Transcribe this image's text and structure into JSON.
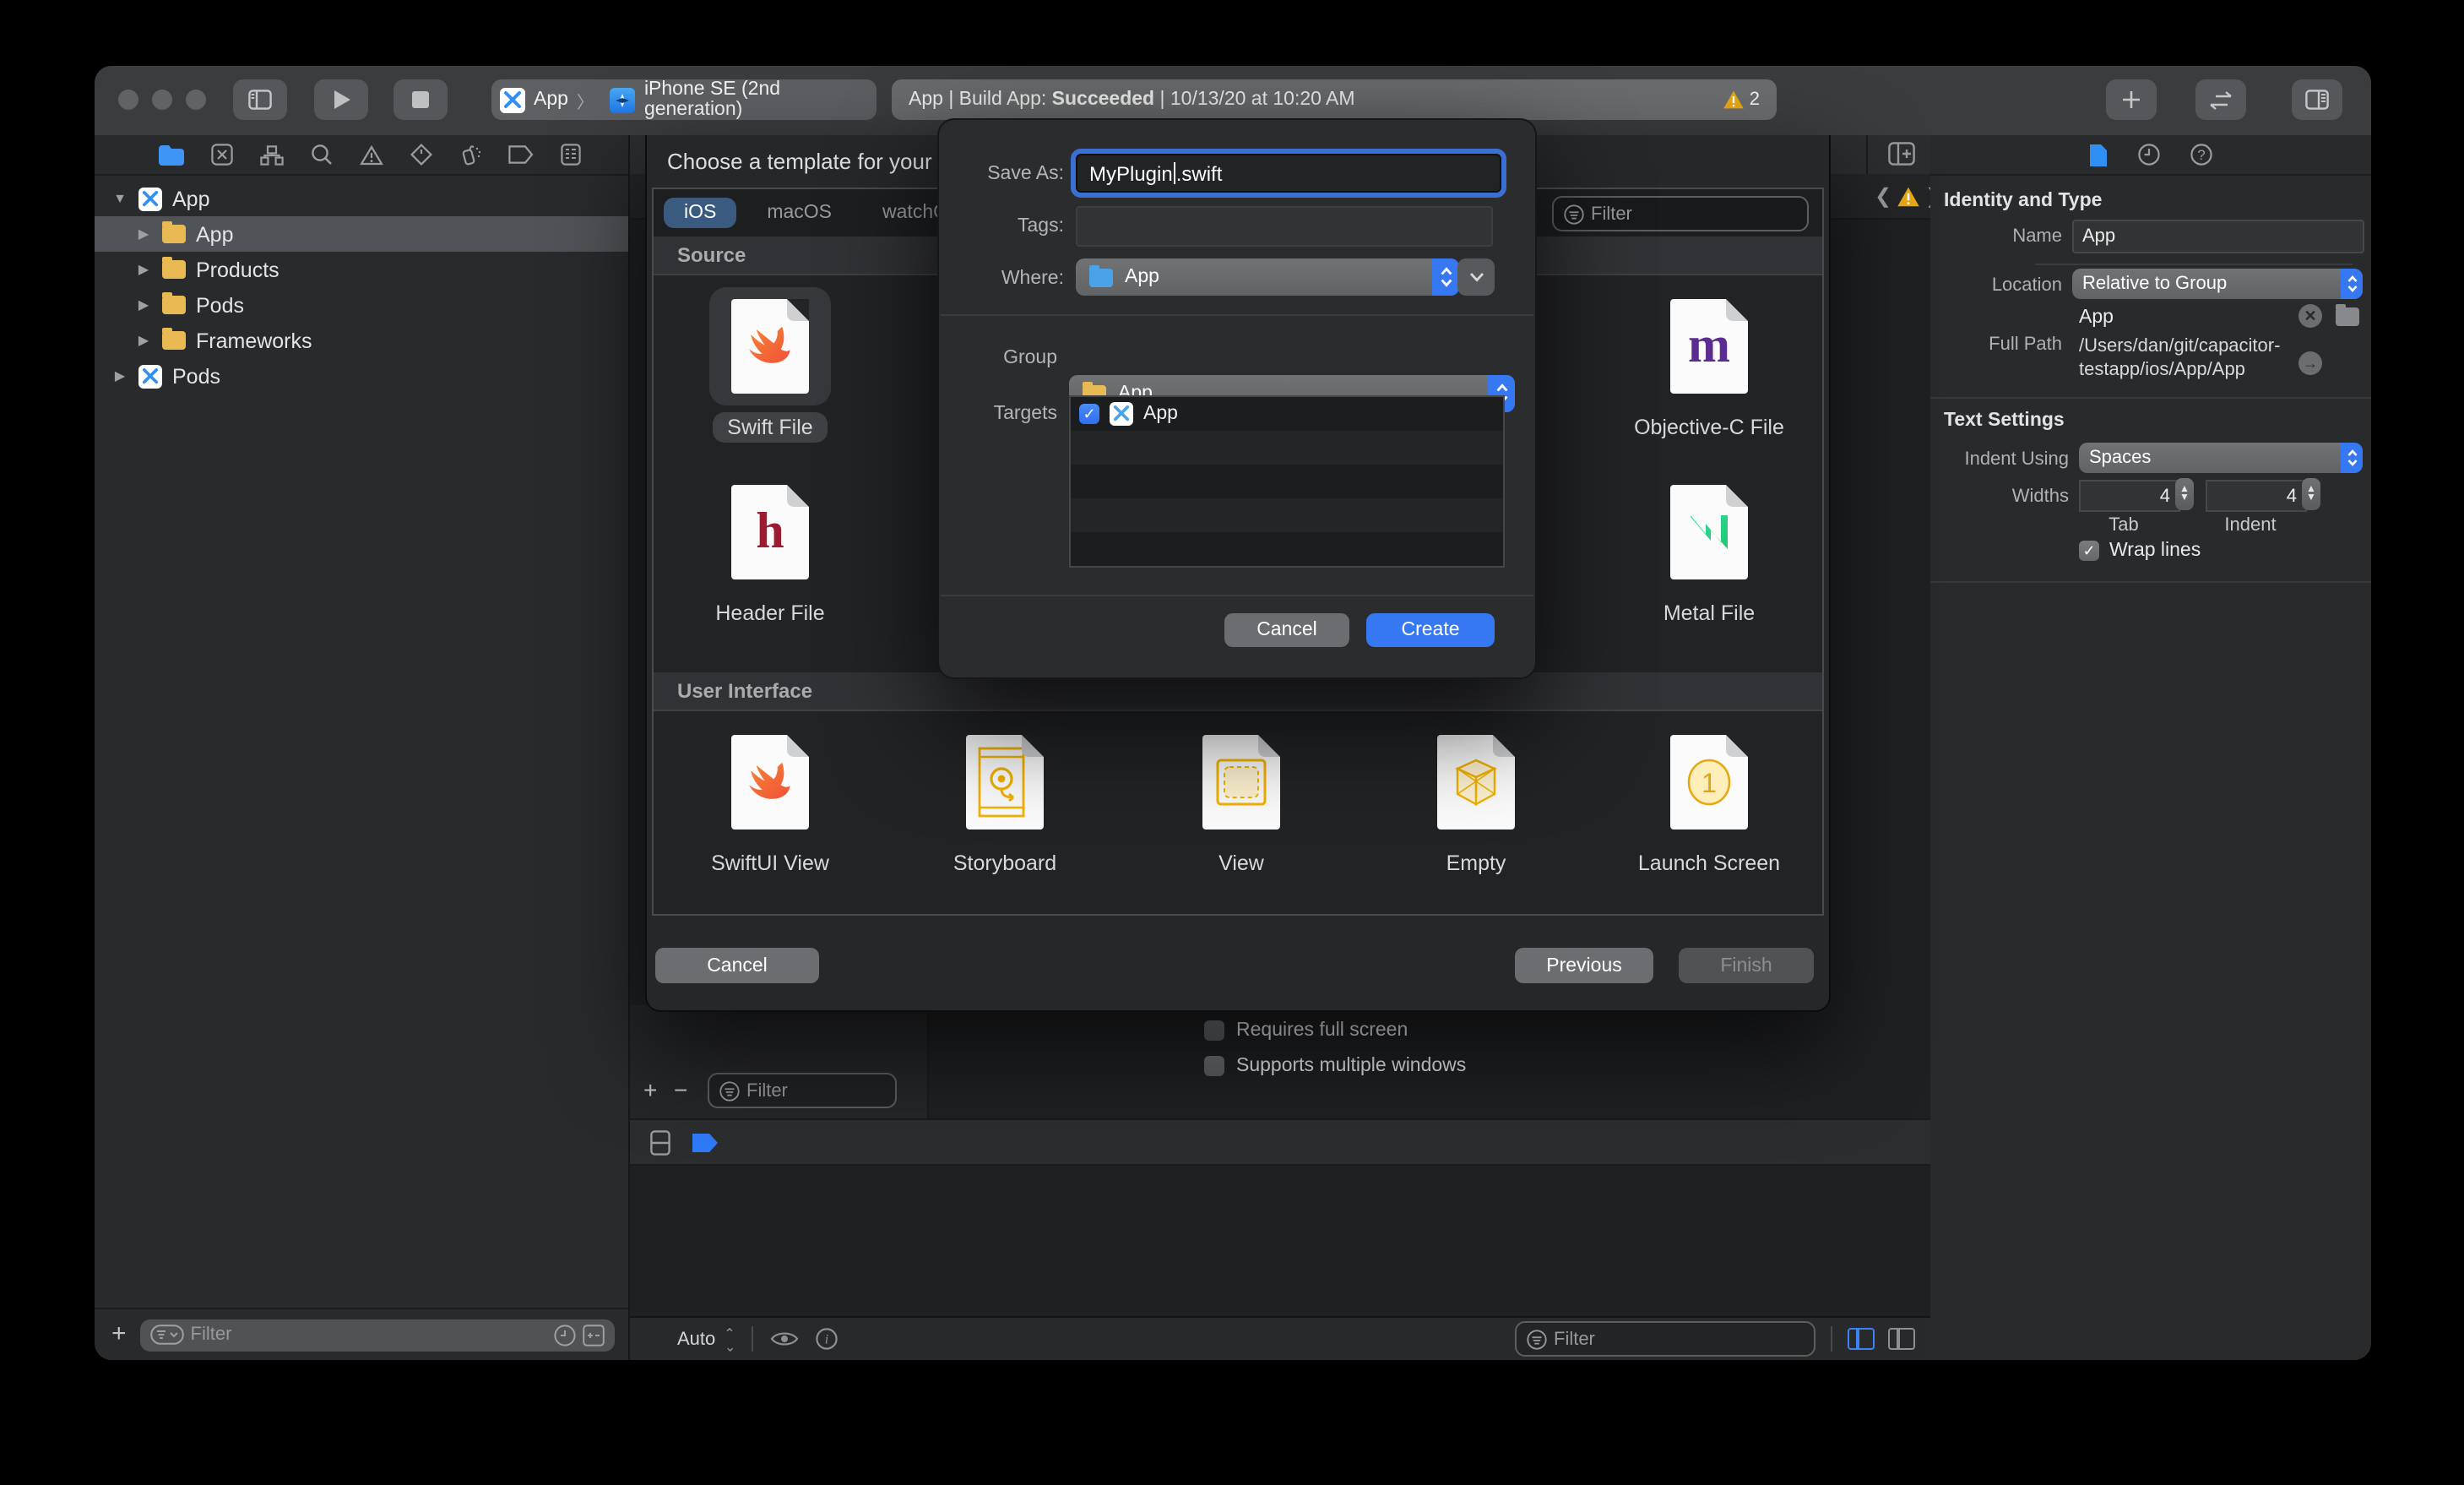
{
  "colors": {
    "accent": "#3678f2",
    "warning": "#f0b429",
    "folder_yellow": "#e9b954",
    "folder_blue": "#4aa3e8",
    "swift_orange": "#f05138",
    "objc_purple": "#5b2d91",
    "header_red": "#9b1b30",
    "metal_green": "#27c993"
  },
  "toolbar": {
    "scheme": {
      "project": "App",
      "separator": "〉",
      "destination": "iPhone SE (2nd generation)"
    },
    "status": {
      "prefix": "App | Build App: ",
      "bold": "Succeeded",
      "suffix": " | 10/13/20 at 10:20 AM",
      "warning_count": "2"
    }
  },
  "navigator": {
    "items": [
      {
        "label": "App",
        "icon": "xcode-project",
        "disclosure": "▼"
      },
      {
        "label": "App",
        "icon": "folder",
        "disclosure": "▶",
        "selected": true
      },
      {
        "label": "Products",
        "icon": "folder",
        "disclosure": "▶"
      },
      {
        "label": "Pods",
        "icon": "folder",
        "disclosure": "▶"
      },
      {
        "label": "Frameworks",
        "icon": "folder",
        "disclosure": "▶"
      },
      {
        "label": "Pods",
        "icon": "xcode-project",
        "disclosure": "▶"
      }
    ],
    "filter_placeholder": "Filter"
  },
  "sheet": {
    "title": "Choose a template for your",
    "tabs": [
      {
        "label": "iOS",
        "selected": true
      },
      {
        "label": "macOS",
        "selected": false
      },
      {
        "label": "watchOS",
        "selected": false
      }
    ],
    "filter_placeholder": "Filter",
    "source_section": "Source",
    "ui_section": "User Interface",
    "source_templates": [
      {
        "label": "Swift File",
        "icon": "swift-file",
        "selected": true
      },
      {
        "label": "Header File",
        "icon": "header-file",
        "selected": false
      },
      {
        "label": "Objective-C File",
        "icon": "objective-c-file",
        "selected": false
      },
      {
        "label": "Metal File",
        "icon": "metal-file",
        "selected": false
      }
    ],
    "ui_templates": [
      {
        "label": "SwiftUI View",
        "icon": "swiftui-view"
      },
      {
        "label": "Storyboard",
        "icon": "storyboard"
      },
      {
        "label": "View",
        "icon": "view"
      },
      {
        "label": "Empty",
        "icon": "empty-cube"
      },
      {
        "label": "Launch Screen",
        "icon": "launch-screen"
      }
    ],
    "buttons": {
      "cancel": "Cancel",
      "previous": "Previous",
      "finish": "Finish"
    }
  },
  "dialog": {
    "save_as_label": "Save As:",
    "save_as_value_head": "MyPlugin",
    "save_as_value_tail": ".swift",
    "tags_label": "Tags:",
    "tags_value": "",
    "where_label": "Where:",
    "where_value": "App",
    "group_label": "Group",
    "group_value": "App",
    "targets_label": "Targets",
    "target_row": {
      "label": "App",
      "checked": true
    },
    "cancel": "Cancel",
    "create": "Create"
  },
  "editor": {
    "checkboxes": [
      {
        "label": "Requires full screen",
        "checked": false
      },
      {
        "label": "Supports multiple windows",
        "checked": false
      }
    ],
    "filter_placeholder": "Filter",
    "debug": {
      "auto_label": "Auto",
      "filter_placeholder": "Filter"
    }
  },
  "inspector": {
    "identity_title": "Identity and Type",
    "name_label": "Name",
    "name_value": "App",
    "location_label": "Location",
    "location_value": "Relative to Group",
    "group_value": "App",
    "fullpath_label": "Full Path",
    "fullpath_line1": "/Users/dan/git/capacitor-",
    "fullpath_line2": "testapp/ios/App/App",
    "text_settings_title": "Text Settings",
    "indent_label": "Indent Using",
    "indent_value": "Spaces",
    "widths_label": "Widths",
    "tab_value": "4",
    "tab_label": "Tab",
    "indent_width_value": "4",
    "indent_width_label": "Indent",
    "wrap_label": "Wrap lines",
    "wrap_checked": true
  }
}
